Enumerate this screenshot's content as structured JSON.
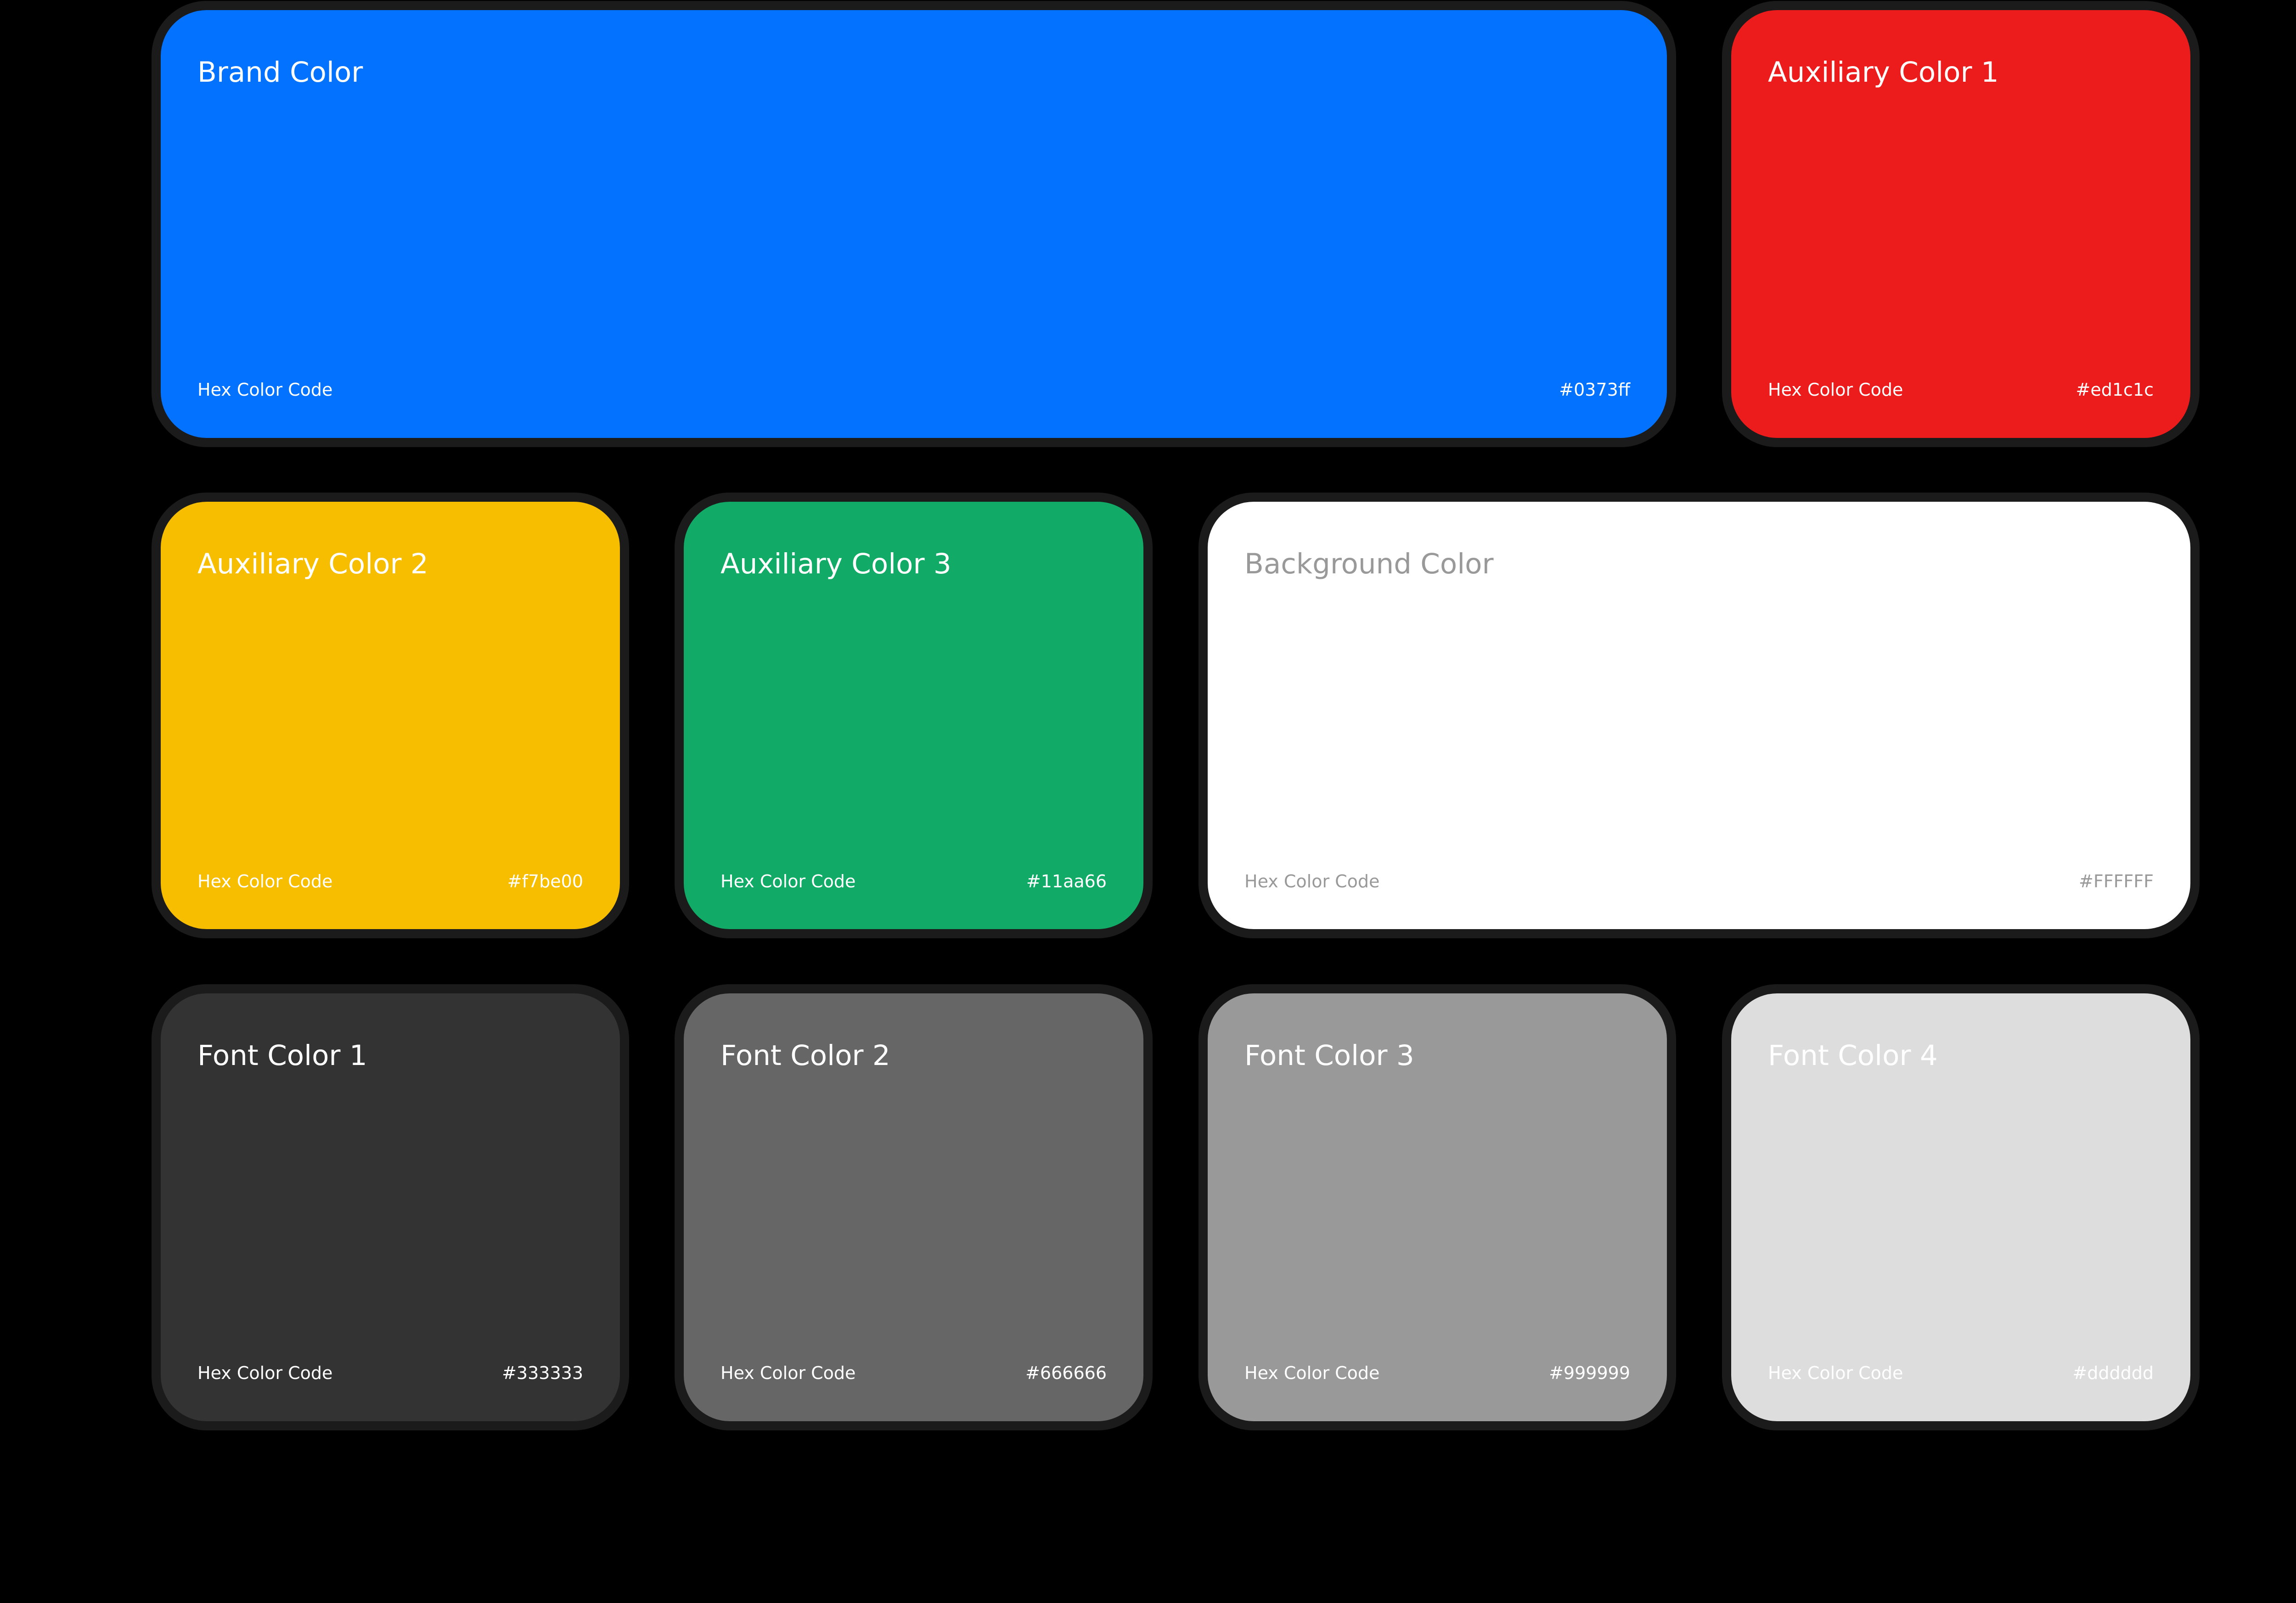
{
  "swatches": [
    {
      "title": "Brand Color",
      "label": "Hex Color Code",
      "hex": "#0373ff",
      "fill": "#0373ff",
      "text_color": "#ffffff"
    },
    {
      "title": "Auxiliary Color 1",
      "label": "Hex Color Code",
      "hex": "#ed1c1c",
      "fill": "#ed1c1c",
      "text_color": "#ffffff"
    },
    {
      "title": "Auxiliary Color 2",
      "label": "Hex Color Code",
      "hex": "#f7be00",
      "fill": "#f7be00",
      "text_color": "#ffffff"
    },
    {
      "title": "Auxiliary Color 3",
      "label": "Hex Color Code",
      "hex": "#11aa66",
      "fill": "#11aa66",
      "text_color": "#ffffff"
    },
    {
      "title": "Background Color",
      "label": "Hex Color Code",
      "hex": "#FFFFFF",
      "fill": "#ffffff",
      "text_color": "#999999"
    },
    {
      "title": "Font Color 1",
      "label": "Hex Color Code",
      "hex": "#333333",
      "fill": "#333333",
      "text_color": "#ffffff"
    },
    {
      "title": "Font Color 2",
      "label": "Hex Color Code",
      "hex": "#666666",
      "fill": "#666666",
      "text_color": "#ffffff"
    },
    {
      "title": "Font Color 3",
      "label": "Hex Color Code",
      "hex": "#999999",
      "fill": "#999999",
      "text_color": "#ffffff"
    },
    {
      "title": "Font Color 4",
      "label": "Hex Color Code",
      "hex": "#dddddd",
      "fill": "#dddddd",
      "text_color": "#ffffff"
    }
  ],
  "page_background": "#000000",
  "card_border": "#1b1b1b"
}
